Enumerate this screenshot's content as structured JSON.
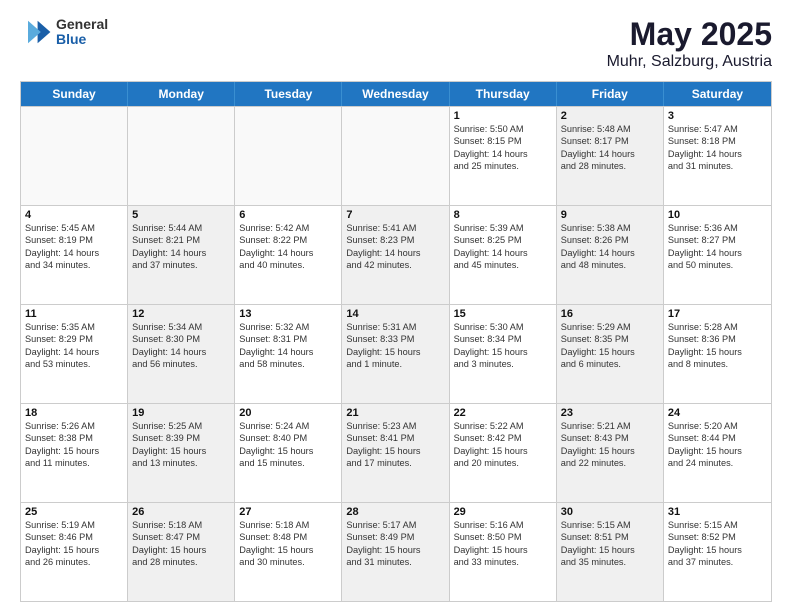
{
  "header": {
    "logo": {
      "general": "General",
      "blue": "Blue"
    },
    "title": "May 2025",
    "subtitle": "Muhr, Salzburg, Austria"
  },
  "weekdays": [
    "Sunday",
    "Monday",
    "Tuesday",
    "Wednesday",
    "Thursday",
    "Friday",
    "Saturday"
  ],
  "rows": [
    [
      {
        "day": "",
        "info": "",
        "empty": true
      },
      {
        "day": "",
        "info": "",
        "empty": true
      },
      {
        "day": "",
        "info": "",
        "empty": true
      },
      {
        "day": "",
        "info": "",
        "empty": true
      },
      {
        "day": "1",
        "info": "Sunrise: 5:50 AM\nSunset: 8:15 PM\nDaylight: 14 hours\nand 25 minutes.",
        "empty": false,
        "shaded": false
      },
      {
        "day": "2",
        "info": "Sunrise: 5:48 AM\nSunset: 8:17 PM\nDaylight: 14 hours\nand 28 minutes.",
        "empty": false,
        "shaded": true
      },
      {
        "day": "3",
        "info": "Sunrise: 5:47 AM\nSunset: 8:18 PM\nDaylight: 14 hours\nand 31 minutes.",
        "empty": false,
        "shaded": false
      }
    ],
    [
      {
        "day": "4",
        "info": "Sunrise: 5:45 AM\nSunset: 8:19 PM\nDaylight: 14 hours\nand 34 minutes.",
        "empty": false,
        "shaded": false
      },
      {
        "day": "5",
        "info": "Sunrise: 5:44 AM\nSunset: 8:21 PM\nDaylight: 14 hours\nand 37 minutes.",
        "empty": false,
        "shaded": true
      },
      {
        "day": "6",
        "info": "Sunrise: 5:42 AM\nSunset: 8:22 PM\nDaylight: 14 hours\nand 40 minutes.",
        "empty": false,
        "shaded": false
      },
      {
        "day": "7",
        "info": "Sunrise: 5:41 AM\nSunset: 8:23 PM\nDaylight: 14 hours\nand 42 minutes.",
        "empty": false,
        "shaded": true
      },
      {
        "day": "8",
        "info": "Sunrise: 5:39 AM\nSunset: 8:25 PM\nDaylight: 14 hours\nand 45 minutes.",
        "empty": false,
        "shaded": false
      },
      {
        "day": "9",
        "info": "Sunrise: 5:38 AM\nSunset: 8:26 PM\nDaylight: 14 hours\nand 48 minutes.",
        "empty": false,
        "shaded": true
      },
      {
        "day": "10",
        "info": "Sunrise: 5:36 AM\nSunset: 8:27 PM\nDaylight: 14 hours\nand 50 minutes.",
        "empty": false,
        "shaded": false
      }
    ],
    [
      {
        "day": "11",
        "info": "Sunrise: 5:35 AM\nSunset: 8:29 PM\nDaylight: 14 hours\nand 53 minutes.",
        "empty": false,
        "shaded": false
      },
      {
        "day": "12",
        "info": "Sunrise: 5:34 AM\nSunset: 8:30 PM\nDaylight: 14 hours\nand 56 minutes.",
        "empty": false,
        "shaded": true
      },
      {
        "day": "13",
        "info": "Sunrise: 5:32 AM\nSunset: 8:31 PM\nDaylight: 14 hours\nand 58 minutes.",
        "empty": false,
        "shaded": false
      },
      {
        "day": "14",
        "info": "Sunrise: 5:31 AM\nSunset: 8:33 PM\nDaylight: 15 hours\nand 1 minute.",
        "empty": false,
        "shaded": true
      },
      {
        "day": "15",
        "info": "Sunrise: 5:30 AM\nSunset: 8:34 PM\nDaylight: 15 hours\nand 3 minutes.",
        "empty": false,
        "shaded": false
      },
      {
        "day": "16",
        "info": "Sunrise: 5:29 AM\nSunset: 8:35 PM\nDaylight: 15 hours\nand 6 minutes.",
        "empty": false,
        "shaded": true
      },
      {
        "day": "17",
        "info": "Sunrise: 5:28 AM\nSunset: 8:36 PM\nDaylight: 15 hours\nand 8 minutes.",
        "empty": false,
        "shaded": false
      }
    ],
    [
      {
        "day": "18",
        "info": "Sunrise: 5:26 AM\nSunset: 8:38 PM\nDaylight: 15 hours\nand 11 minutes.",
        "empty": false,
        "shaded": false
      },
      {
        "day": "19",
        "info": "Sunrise: 5:25 AM\nSunset: 8:39 PM\nDaylight: 15 hours\nand 13 minutes.",
        "empty": false,
        "shaded": true
      },
      {
        "day": "20",
        "info": "Sunrise: 5:24 AM\nSunset: 8:40 PM\nDaylight: 15 hours\nand 15 minutes.",
        "empty": false,
        "shaded": false
      },
      {
        "day": "21",
        "info": "Sunrise: 5:23 AM\nSunset: 8:41 PM\nDaylight: 15 hours\nand 17 minutes.",
        "empty": false,
        "shaded": true
      },
      {
        "day": "22",
        "info": "Sunrise: 5:22 AM\nSunset: 8:42 PM\nDaylight: 15 hours\nand 20 minutes.",
        "empty": false,
        "shaded": false
      },
      {
        "day": "23",
        "info": "Sunrise: 5:21 AM\nSunset: 8:43 PM\nDaylight: 15 hours\nand 22 minutes.",
        "empty": false,
        "shaded": true
      },
      {
        "day": "24",
        "info": "Sunrise: 5:20 AM\nSunset: 8:44 PM\nDaylight: 15 hours\nand 24 minutes.",
        "empty": false,
        "shaded": false
      }
    ],
    [
      {
        "day": "25",
        "info": "Sunrise: 5:19 AM\nSunset: 8:46 PM\nDaylight: 15 hours\nand 26 minutes.",
        "empty": false,
        "shaded": false
      },
      {
        "day": "26",
        "info": "Sunrise: 5:18 AM\nSunset: 8:47 PM\nDaylight: 15 hours\nand 28 minutes.",
        "empty": false,
        "shaded": true
      },
      {
        "day": "27",
        "info": "Sunrise: 5:18 AM\nSunset: 8:48 PM\nDaylight: 15 hours\nand 30 minutes.",
        "empty": false,
        "shaded": false
      },
      {
        "day": "28",
        "info": "Sunrise: 5:17 AM\nSunset: 8:49 PM\nDaylight: 15 hours\nand 31 minutes.",
        "empty": false,
        "shaded": true
      },
      {
        "day": "29",
        "info": "Sunrise: 5:16 AM\nSunset: 8:50 PM\nDaylight: 15 hours\nand 33 minutes.",
        "empty": false,
        "shaded": false
      },
      {
        "day": "30",
        "info": "Sunrise: 5:15 AM\nSunset: 8:51 PM\nDaylight: 15 hours\nand 35 minutes.",
        "empty": false,
        "shaded": true
      },
      {
        "day": "31",
        "info": "Sunrise: 5:15 AM\nSunset: 8:52 PM\nDaylight: 15 hours\nand 37 minutes.",
        "empty": false,
        "shaded": false
      }
    ]
  ]
}
